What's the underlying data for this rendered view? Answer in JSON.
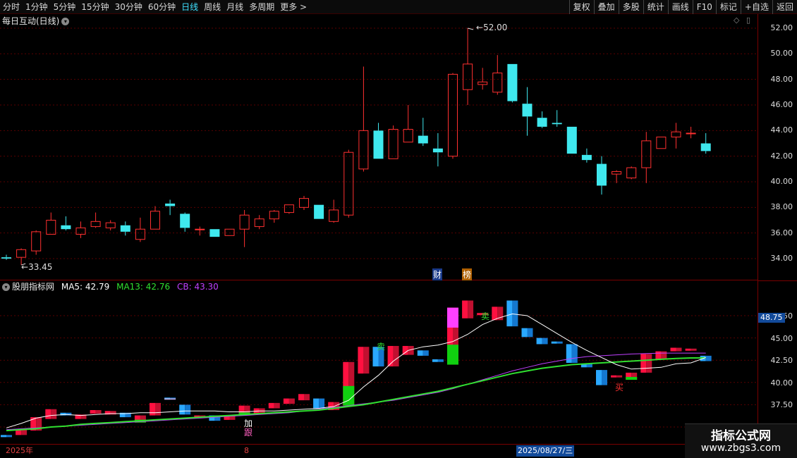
{
  "toolbar": {
    "periods": [
      "分时",
      "1分钟",
      "5分钟",
      "15分钟",
      "30分钟",
      "60分钟",
      "日线",
      "周线",
      "月线",
      "多周期",
      "更多 >"
    ],
    "active_period": "日线",
    "tools": [
      "复权",
      "叠加",
      "多股",
      "统计",
      "画线",
      "F10",
      "标记",
      "+自选",
      "返回"
    ]
  },
  "main_panel": {
    "title": "每日互动(日线)",
    "high_label": "52.00",
    "low_label": "33.45",
    "badges": [
      "财",
      "榜"
    ]
  },
  "indicator_panel": {
    "title": "股朋指标网",
    "ma5_label": "MA5: 42.79",
    "ma13_label": "MA13: 42.76",
    "cb_label": "CB: 43.30",
    "current_value": "48.75",
    "signals": {
      "sell1": "卖",
      "sell2": "卖",
      "buy": "买",
      "add": "加",
      "follow": "跟"
    }
  },
  "bottom": {
    "year": "2025年",
    "mid_tick": "8",
    "selected_date": "2025/08/27/三"
  },
  "watermark": {
    "title": "指标公式网",
    "url": "www.zbgs3.com"
  },
  "colors": {
    "up": "#ff3030",
    "down": "#3fe8ee",
    "ma5": "#ffffff",
    "ma13": "#30e030",
    "cb": "#c040ff",
    "axis": "#7a0000"
  },
  "chart_data": {
    "type": "candlestick",
    "main_ylim": [
      33.0,
      53.0
    ],
    "main_yticks": [
      "52.00",
      "50.00",
      "48.00",
      "46.00",
      "44.00",
      "42.00",
      "40.00",
      "38.00",
      "36.00",
      "34.00"
    ],
    "sub_ylim": [
      34.2,
      49.0
    ],
    "sub_yticks": [
      "47.50",
      "45.00",
      "42.50",
      "40.00",
      "37.50",
      "35.00"
    ],
    "candles": [
      [
        34.1,
        34.3,
        33.9,
        34.0
      ],
      [
        34.1,
        34.8,
        33.5,
        34.7
      ],
      [
        34.6,
        36.2,
        34.3,
        36.1
      ],
      [
        35.9,
        37.6,
        35.9,
        37.0
      ],
      [
        36.6,
        37.3,
        36.2,
        36.3
      ],
      [
        35.9,
        36.9,
        35.6,
        36.4
      ],
      [
        36.5,
        37.6,
        36.4,
        36.9
      ],
      [
        36.4,
        37.0,
        36.2,
        36.8
      ],
      [
        36.6,
        36.9,
        35.8,
        36.1
      ],
      [
        35.5,
        37.2,
        35.3,
        36.3
      ],
      [
        36.3,
        38.1,
        36.3,
        37.7
      ],
      [
        38.3,
        38.6,
        37.4,
        38.1
      ],
      [
        37.5,
        37.6,
        36.1,
        36.4
      ],
      [
        36.3,
        36.5,
        35.8,
        36.3
      ],
      [
        36.3,
        36.3,
        35.7,
        35.7
      ],
      [
        35.8,
        36.3,
        35.8,
        36.3
      ],
      [
        36.3,
        37.8,
        34.9,
        37.4
      ],
      [
        36.5,
        37.4,
        36.3,
        37.1
      ],
      [
        37.1,
        37.8,
        36.8,
        37.7
      ],
      [
        37.6,
        38.2,
        37.5,
        38.2
      ],
      [
        38.0,
        38.9,
        37.8,
        38.7
      ],
      [
        38.2,
        38.2,
        37.1,
        37.1
      ],
      [
        36.9,
        38.6,
        36.8,
        37.8
      ],
      [
        37.4,
        42.5,
        37.2,
        42.3
      ],
      [
        41.0,
        49.0,
        40.8,
        44.0
      ],
      [
        44.0,
        44.6,
        41.8,
        41.8
      ],
      [
        41.8,
        44.4,
        41.8,
        44.1
      ],
      [
        43.1,
        46.0,
        43.1,
        44.1
      ],
      [
        43.6,
        45.0,
        42.8,
        43.0
      ],
      [
        42.6,
        43.8,
        41.2,
        42.3
      ],
      [
        42.0,
        48.5,
        41.8,
        48.4
      ],
      [
        47.2,
        52.0,
        46.0,
        49.2
      ],
      [
        47.6,
        48.9,
        47.2,
        47.8
      ],
      [
        47.0,
        49.9,
        46.8,
        48.5
      ],
      [
        49.2,
        49.2,
        46.2,
        46.3
      ],
      [
        46.1,
        47.4,
        43.6,
        45.1
      ],
      [
        45.0,
        45.5,
        44.2,
        44.3
      ],
      [
        44.6,
        45.6,
        44.3,
        44.5
      ],
      [
        44.3,
        44.3,
        42.2,
        42.2
      ],
      [
        42.1,
        42.6,
        41.5,
        41.7
      ],
      [
        41.4,
        42.0,
        39.0,
        39.7
      ],
      [
        40.6,
        40.9,
        39.9,
        40.8
      ],
      [
        40.3,
        41.2,
        40.2,
        41.1
      ],
      [
        41.1,
        43.9,
        39.9,
        43.2
      ],
      [
        42.6,
        43.5,
        42.6,
        43.5
      ],
      [
        43.5,
        44.6,
        42.6,
        43.9
      ],
      [
        43.8,
        44.3,
        43.4,
        43.8
      ],
      [
        43.0,
        43.8,
        42.2,
        42.4
      ]
    ],
    "ma5": [
      34.9,
      35.4,
      36.0,
      36.3,
      36.4,
      36.3,
      36.4,
      36.5,
      36.5,
      36.6,
      36.6,
      36.7,
      36.8,
      36.8,
      36.8,
      36.7,
      36.7,
      36.8,
      36.8,
      36.9,
      37.0,
      37.1,
      37.3,
      38.0,
      39.5,
      40.8,
      42.4,
      43.6,
      44.0,
      44.2,
      44.6,
      45.4,
      46.5,
      47.2,
      47.7,
      47.5,
      46.5,
      45.5,
      44.5,
      43.6,
      42.8,
      42.0,
      41.5,
      41.6,
      41.7,
      42.1,
      42.2,
      42.8
    ],
    "ma13": [
      34.6,
      34.7,
      34.8,
      35.0,
      35.1,
      35.3,
      35.4,
      35.5,
      35.6,
      35.7,
      35.8,
      35.9,
      36.0,
      36.1,
      36.2,
      36.3,
      36.4,
      36.5,
      36.6,
      36.7,
      36.8,
      36.9,
      37.1,
      37.3,
      37.5,
      37.8,
      38.1,
      38.4,
      38.7,
      39.0,
      39.4,
      39.8,
      40.2,
      40.6,
      41.0,
      41.3,
      41.6,
      41.8,
      42.0,
      42.1,
      42.2,
      42.3,
      42.4,
      42.5,
      42.6,
      42.7,
      42.75,
      42.76
    ],
    "cb": [
      34.7,
      34.8,
      34.9,
      35.0,
      35.1,
      35.2,
      35.3,
      35.4,
      35.5,
      35.6,
      35.7,
      35.8,
      35.9,
      36.0,
      36.1,
      36.2,
      36.3,
      36.4,
      36.5,
      36.6,
      36.8,
      37.0,
      37.2,
      37.4,
      37.6,
      37.8,
      38.0,
      38.3,
      38.6,
      38.9,
      39.3,
      39.8,
      40.3,
      40.8,
      41.3,
      41.7,
      42.1,
      42.4,
      42.7,
      42.9,
      43.0,
      43.1,
      43.2,
      43.25,
      43.3,
      43.3,
      43.3,
      43.3
    ]
  }
}
